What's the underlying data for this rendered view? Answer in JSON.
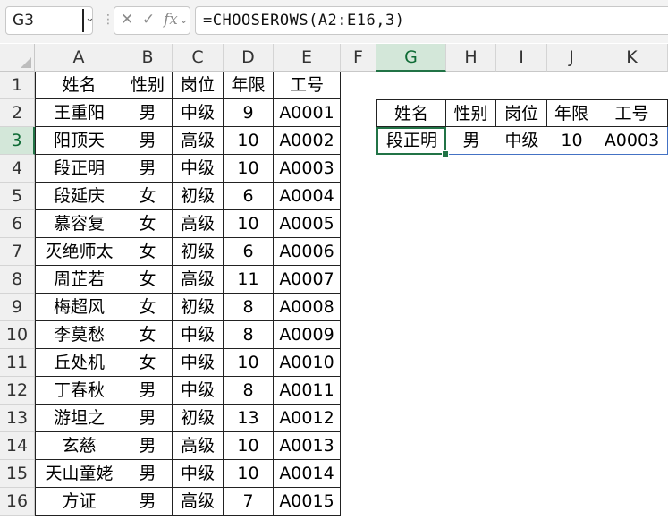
{
  "name_box": "G3",
  "fx_icons": [
    "close-icon",
    "check-icon",
    "fx-icon"
  ],
  "formula": "=CHOOSEROWS(A2:E16,3)",
  "columns": [
    "A",
    "B",
    "C",
    "D",
    "E",
    "F",
    "G",
    "H",
    "I",
    "J",
    "K"
  ],
  "selected_column": "G",
  "selected_row": 3,
  "rows": [
    "1",
    "2",
    "3",
    "4",
    "5",
    "6",
    "7",
    "8",
    "9",
    "10",
    "11",
    "12",
    "13",
    "14",
    "15",
    "16"
  ],
  "table": {
    "headers": [
      "姓名",
      "性别",
      "岗位",
      "年限",
      "工号"
    ],
    "records": [
      [
        "王重阳",
        "男",
        "中级",
        "9",
        "A0001"
      ],
      [
        "阳顶天",
        "男",
        "高级",
        "10",
        "A0002"
      ],
      [
        "段正明",
        "男",
        "中级",
        "10",
        "A0003"
      ],
      [
        "段延庆",
        "女",
        "初级",
        "6",
        "A0004"
      ],
      [
        "慕容复",
        "女",
        "高级",
        "10",
        "A0005"
      ],
      [
        "灭绝师太",
        "女",
        "初级",
        "6",
        "A0006"
      ],
      [
        "周芷若",
        "女",
        "高级",
        "11",
        "A0007"
      ],
      [
        "梅超风",
        "女",
        "初级",
        "8",
        "A0008"
      ],
      [
        "李莫愁",
        "女",
        "中级",
        "8",
        "A0009"
      ],
      [
        "丘处机",
        "女",
        "中级",
        "10",
        "A0010"
      ],
      [
        "丁春秋",
        "男",
        "中级",
        "8",
        "A0011"
      ],
      [
        "游坦之",
        "男",
        "初级",
        "13",
        "A0012"
      ],
      [
        "玄慈",
        "男",
        "高级",
        "10",
        "A0013"
      ],
      [
        "天山童姥",
        "男",
        "中级",
        "10",
        "A0014"
      ],
      [
        "方证",
        "男",
        "高级",
        "7",
        "A0015"
      ]
    ]
  },
  "result": {
    "headers": [
      "姓名",
      "性别",
      "岗位",
      "年限",
      "工号"
    ],
    "values": [
      "段正明",
      "男",
      "中级",
      "10",
      "A0003"
    ]
  },
  "colors": {
    "accent": "#217346",
    "header_bg": "#f0f0f0",
    "selected_header_bg": "#d3e7d9",
    "result_border": "#4472c4"
  }
}
